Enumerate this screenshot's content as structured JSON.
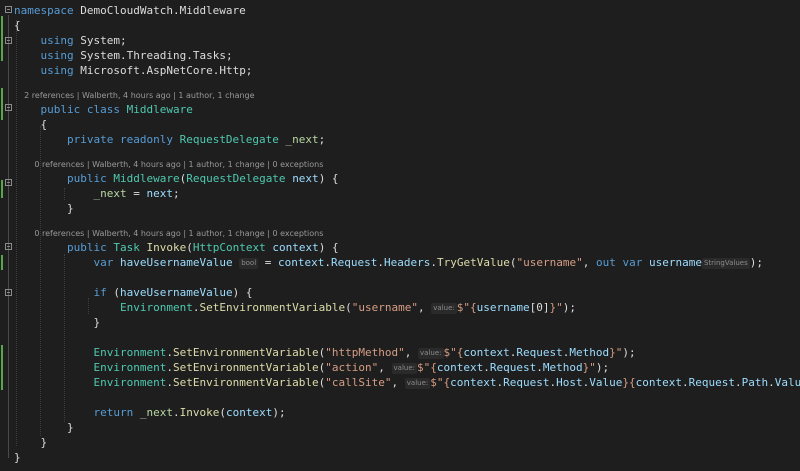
{
  "colors": {
    "background": "#1e1e1e",
    "keyword": "#569cd6",
    "type": "#4ec9b0",
    "string": "#d69d85",
    "member": "#dcdcaa",
    "parameter": "#9cdcfe",
    "field": "#b8d7a3",
    "text": "#dcdcdc",
    "lens": "#999999",
    "hint": "#8c8c8c",
    "change_bar": "#57a64a"
  },
  "code": [
    {
      "kind": "code",
      "segs": [
        [
          "namespace",
          "kw"
        ],
        [
          " DemoCloudWatch.Middleware",
          "tx"
        ]
      ]
    },
    {
      "kind": "code",
      "segs": [
        [
          "{",
          "tx"
        ]
      ]
    },
    {
      "kind": "code",
      "segs": [
        [
          "    ",
          "tx"
        ],
        [
          "using",
          "kw"
        ],
        [
          " System;",
          "tx"
        ]
      ]
    },
    {
      "kind": "code",
      "segs": [
        [
          "    ",
          "tx"
        ],
        [
          "using",
          "kw"
        ],
        [
          " System.Threading.Tasks;",
          "tx"
        ]
      ]
    },
    {
      "kind": "code",
      "segs": [
        [
          "    ",
          "tx"
        ],
        [
          "using",
          "kw"
        ],
        [
          " Microsoft.AspNetCore.Http;",
          "tx"
        ]
      ]
    },
    {
      "kind": "blank",
      "segs": []
    },
    {
      "kind": "lens",
      "text": "    2 references | Walberth, 4 hours ago | 1 author, 1 change"
    },
    {
      "kind": "code",
      "segs": [
        [
          "    ",
          "tx"
        ],
        [
          "public",
          "kw"
        ],
        [
          " ",
          "tx"
        ],
        [
          "class",
          "kw"
        ],
        [
          " ",
          "tx"
        ],
        [
          "Middleware",
          "ty"
        ]
      ]
    },
    {
      "kind": "code",
      "segs": [
        [
          "    {",
          "tx"
        ]
      ]
    },
    {
      "kind": "code",
      "segs": [
        [
          "        ",
          "tx"
        ],
        [
          "private",
          "kw"
        ],
        [
          " ",
          "tx"
        ],
        [
          "readonly",
          "kw"
        ],
        [
          " ",
          "tx"
        ],
        [
          "RequestDelegate",
          "ty"
        ],
        [
          " ",
          "tx"
        ],
        [
          "_next",
          "fd"
        ],
        [
          ";",
          "tx"
        ]
      ]
    },
    {
      "kind": "blank",
      "segs": []
    },
    {
      "kind": "lens",
      "text": "        0 references | Walberth, 4 hours ago | 1 author, 1 change | 0 exceptions"
    },
    {
      "kind": "code",
      "segs": [
        [
          "        ",
          "tx"
        ],
        [
          "public",
          "kw"
        ],
        [
          " ",
          "tx"
        ],
        [
          "Middleware",
          "ty"
        ],
        [
          "(",
          "tx"
        ],
        [
          "RequestDelegate",
          "ty"
        ],
        [
          " ",
          "tx"
        ],
        [
          "next",
          "pr"
        ],
        [
          ") {",
          "tx"
        ]
      ]
    },
    {
      "kind": "code",
      "segs": [
        [
          "            ",
          "tx"
        ],
        [
          "_next",
          "fd"
        ],
        [
          " = ",
          "tx"
        ],
        [
          "next",
          "pr"
        ],
        [
          ";",
          "tx"
        ]
      ]
    },
    {
      "kind": "code",
      "segs": [
        [
          "        }",
          "tx"
        ]
      ]
    },
    {
      "kind": "blank",
      "segs": []
    },
    {
      "kind": "lens",
      "text": "        0 references | Walberth, 4 hours ago | 1 author, 1 change | 0 exceptions"
    },
    {
      "kind": "code",
      "segs": [
        [
          "        ",
          "tx"
        ],
        [
          "public",
          "kw"
        ],
        [
          " ",
          "tx"
        ],
        [
          "Task",
          "ty"
        ],
        [
          " ",
          "tx"
        ],
        [
          "Invoke",
          "mb"
        ],
        [
          "(",
          "tx"
        ],
        [
          "HttpContext",
          "ty"
        ],
        [
          " ",
          "tx"
        ],
        [
          "context",
          "pr"
        ],
        [
          ") {",
          "tx"
        ]
      ]
    },
    {
      "kind": "code",
      "segs": [
        [
          "            ",
          "tx"
        ],
        [
          "var",
          "kw"
        ],
        [
          " ",
          "tx"
        ],
        [
          "haveUsernameValue",
          "pr"
        ],
        [
          " ",
          "tx"
        ],
        [
          "bool",
          "hint"
        ],
        [
          " = ",
          "tx"
        ],
        [
          "context",
          "pr"
        ],
        [
          ".",
          "tx"
        ],
        [
          "Request",
          "pr"
        ],
        [
          ".",
          "tx"
        ],
        [
          "Headers",
          "pr"
        ],
        [
          ".",
          "tx"
        ],
        [
          "TryGetValue",
          "mb"
        ],
        [
          "(",
          "tx"
        ],
        [
          "\"username\"",
          "st"
        ],
        [
          ", ",
          "tx"
        ],
        [
          "out",
          "kw"
        ],
        [
          " ",
          "tx"
        ],
        [
          "var",
          "kw"
        ],
        [
          " ",
          "tx"
        ],
        [
          "username",
          "pr"
        ],
        [
          "StringValues",
          "hint"
        ],
        [
          ");",
          "tx"
        ]
      ]
    },
    {
      "kind": "blank",
      "segs": []
    },
    {
      "kind": "code",
      "segs": [
        [
          "            ",
          "tx"
        ],
        [
          "if",
          "kw"
        ],
        [
          " (",
          "tx"
        ],
        [
          "haveUsernameValue",
          "pr"
        ],
        [
          ") {",
          "tx"
        ]
      ]
    },
    {
      "kind": "code",
      "segs": [
        [
          "                ",
          "tx"
        ],
        [
          "Environment",
          "ty"
        ],
        [
          ".",
          "tx"
        ],
        [
          "SetEnvironmentVariable",
          "mb"
        ],
        [
          "(",
          "tx"
        ],
        [
          "\"username\"",
          "st"
        ],
        [
          ", ",
          "tx"
        ],
        [
          "value:",
          "hint"
        ],
        [
          "$\"{",
          "st"
        ],
        [
          "username",
          "pr"
        ],
        [
          "[0]",
          "tx"
        ],
        [
          "}\"",
          "st"
        ],
        [
          ");",
          "tx"
        ]
      ]
    },
    {
      "kind": "code",
      "segs": [
        [
          "            }",
          "tx"
        ]
      ]
    },
    {
      "kind": "blank",
      "segs": []
    },
    {
      "kind": "code",
      "segs": [
        [
          "            ",
          "tx"
        ],
        [
          "Environment",
          "ty"
        ],
        [
          ".",
          "tx"
        ],
        [
          "SetEnvironmentVariable",
          "mb"
        ],
        [
          "(",
          "tx"
        ],
        [
          "\"httpMethod\"",
          "st"
        ],
        [
          ", ",
          "tx"
        ],
        [
          "value:",
          "hint"
        ],
        [
          "$\"{",
          "st"
        ],
        [
          "context",
          "pr"
        ],
        [
          ".",
          "tx"
        ],
        [
          "Request",
          "pr"
        ],
        [
          ".",
          "tx"
        ],
        [
          "Method",
          "pr"
        ],
        [
          "}\"",
          "st"
        ],
        [
          ");",
          "tx"
        ]
      ]
    },
    {
      "kind": "code",
      "segs": [
        [
          "            ",
          "tx"
        ],
        [
          "Environment",
          "ty"
        ],
        [
          ".",
          "tx"
        ],
        [
          "SetEnvironmentVariable",
          "mb"
        ],
        [
          "(",
          "tx"
        ],
        [
          "\"action\"",
          "st"
        ],
        [
          ", ",
          "tx"
        ],
        [
          "value:",
          "hint"
        ],
        [
          "$\"{",
          "st"
        ],
        [
          "context",
          "pr"
        ],
        [
          ".",
          "tx"
        ],
        [
          "Request",
          "pr"
        ],
        [
          ".",
          "tx"
        ],
        [
          "Method",
          "pr"
        ],
        [
          "}\"",
          "st"
        ],
        [
          ");",
          "tx"
        ]
      ]
    },
    {
      "kind": "code",
      "segs": [
        [
          "            ",
          "tx"
        ],
        [
          "Environment",
          "ty"
        ],
        [
          ".",
          "tx"
        ],
        [
          "SetEnvironmentVariable",
          "mb"
        ],
        [
          "(",
          "tx"
        ],
        [
          "\"callSite\"",
          "st"
        ],
        [
          ", ",
          "tx"
        ],
        [
          "value:",
          "hint"
        ],
        [
          "$\"{",
          "st"
        ],
        [
          "context",
          "pr"
        ],
        [
          ".",
          "tx"
        ],
        [
          "Request",
          "pr"
        ],
        [
          ".",
          "tx"
        ],
        [
          "Host",
          "pr"
        ],
        [
          ".",
          "tx"
        ],
        [
          "Value",
          "pr"
        ],
        [
          "}{",
          "st"
        ],
        [
          "context",
          "pr"
        ],
        [
          ".",
          "tx"
        ],
        [
          "Request",
          "pr"
        ],
        [
          ".",
          "tx"
        ],
        [
          "Path",
          "pr"
        ],
        [
          ".",
          "tx"
        ],
        [
          "Value",
          "pr"
        ],
        [
          "}\"",
          "st"
        ],
        [
          ");",
          "tx"
        ]
      ]
    },
    {
      "kind": "blank",
      "segs": []
    },
    {
      "kind": "code",
      "segs": [
        [
          "            ",
          "tx"
        ],
        [
          "return",
          "kw"
        ],
        [
          " ",
          "tx"
        ],
        [
          "_next",
          "fd"
        ],
        [
          ".",
          "tx"
        ],
        [
          "Invoke",
          "mb"
        ],
        [
          "(",
          "tx"
        ],
        [
          "context",
          "pr"
        ],
        [
          ");",
          "tx"
        ]
      ]
    },
    {
      "kind": "code",
      "segs": [
        [
          "        }",
          "tx"
        ]
      ]
    },
    {
      "kind": "code",
      "segs": [
        [
          "    }",
          "tx"
        ]
      ]
    },
    {
      "kind": "code",
      "segs": [
        [
          "}",
          "tx"
        ]
      ]
    }
  ]
}
